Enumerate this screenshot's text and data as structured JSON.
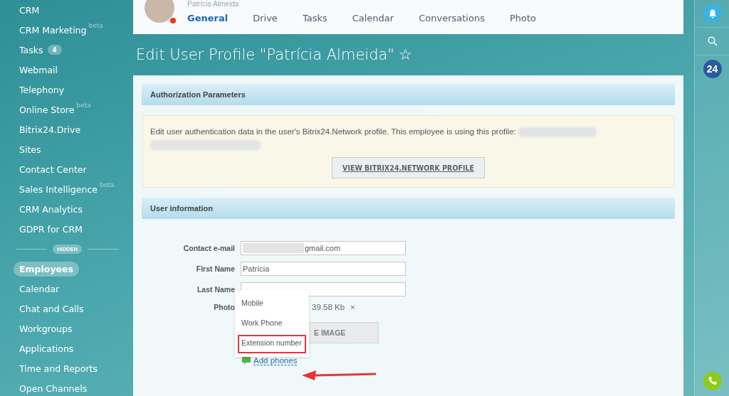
{
  "sidebar": {
    "items": [
      {
        "label": "CRM",
        "selected": false
      },
      {
        "label": "CRM Marketing",
        "superscript": "beta",
        "selected": false
      },
      {
        "label": "Tasks",
        "counter": "4",
        "selected": false
      },
      {
        "label": "Webmail",
        "selected": false
      },
      {
        "label": "Telephony",
        "selected": false
      },
      {
        "label": "Online Store",
        "superscript": "beta",
        "selected": false
      },
      {
        "label": "Bitrix24.Drive",
        "selected": false
      },
      {
        "label": "Sites",
        "selected": false
      },
      {
        "label": "Contact Center",
        "selected": false
      },
      {
        "label": "Sales Intelligence",
        "superscript": "beta",
        "selected": false
      },
      {
        "label": "CRM Analytics",
        "selected": false
      },
      {
        "label": "GDPR for CRM",
        "selected": false
      }
    ],
    "divider_label": "HIDDEN",
    "hidden_items": [
      {
        "label": "Employees",
        "selected": true
      },
      {
        "label": "Calendar",
        "selected": false
      },
      {
        "label": "Chat and Calls",
        "selected": false
      },
      {
        "label": "Workgroups",
        "selected": false
      },
      {
        "label": "Applications",
        "selected": false
      },
      {
        "label": "Time and Reports",
        "selected": false
      },
      {
        "label": "Open Channels",
        "selected": false
      }
    ]
  },
  "profile_header": {
    "name": "Patrícia Almeida",
    "online": true,
    "tabs": [
      {
        "label": "General",
        "selected": true
      },
      {
        "label": "Drive",
        "selected": false
      },
      {
        "label": "Tasks",
        "selected": false
      },
      {
        "label": "Calendar",
        "selected": false
      },
      {
        "label": "Conversations",
        "selected": false
      },
      {
        "label": "Photo",
        "selected": false
      }
    ]
  },
  "page_title": "Edit User Profile \"Patrícia Almeida\"",
  "favorite_star": "☆",
  "authorization": {
    "heading": "Authorization Parameters",
    "text": "Edit user authentication data in the user's Bitrix24.Network profile. This employee is using this profile:",
    "button": "VIEW BITRIX24.NETWORK PROFILE"
  },
  "user_information": {
    "heading": "User information",
    "fields": [
      {
        "label": "Contact e-mail",
        "value": "gmail.com",
        "redacted": true
      },
      {
        "label": "First Name",
        "value": "Patrícia"
      },
      {
        "label": "Last Name"
      }
    ],
    "photo": {
      "label": "Photo",
      "size": "39.58 Kb",
      "remove": "×",
      "button": "E IMAGE"
    },
    "add_phones": "Add phones",
    "phone_menu": [
      {
        "label": "Mobile",
        "highlighted": false
      },
      {
        "label": "Work Phone",
        "highlighted": false
      },
      {
        "label": "Extension number",
        "highlighted": true
      }
    ]
  },
  "right_bar": {
    "logo": "24"
  }
}
